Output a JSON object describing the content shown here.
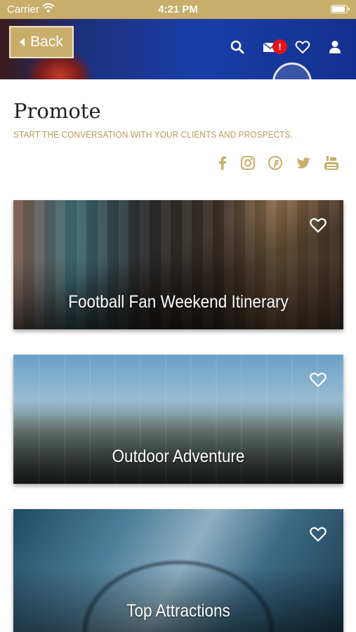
{
  "status_bar": {
    "carrier": "Carrier",
    "time": "4:21 PM"
  },
  "header": {
    "back_label": "Back",
    "notification_badge": "!",
    "icons": [
      "search-icon",
      "mail-icon",
      "heart-icon",
      "user-icon"
    ]
  },
  "page": {
    "title": "Promote",
    "subtitle": "START THE CONVERSATION WITH YOUR CLIENTS AND PROSPECTS.",
    "social_icons": [
      "facebook-icon",
      "instagram-icon",
      "pinterest-icon",
      "twitter-icon",
      "youtube-icon"
    ]
  },
  "cards": [
    {
      "label": "Football Fan Weekend Itinerary"
    },
    {
      "label": "Outdoor Adventure"
    },
    {
      "label": "Top Attractions"
    }
  ],
  "colors": {
    "gold": "#c9ad6a",
    "gold_text": "#b79a55",
    "header_blue": "#1a3ea8",
    "badge_red": "#e1141b"
  }
}
